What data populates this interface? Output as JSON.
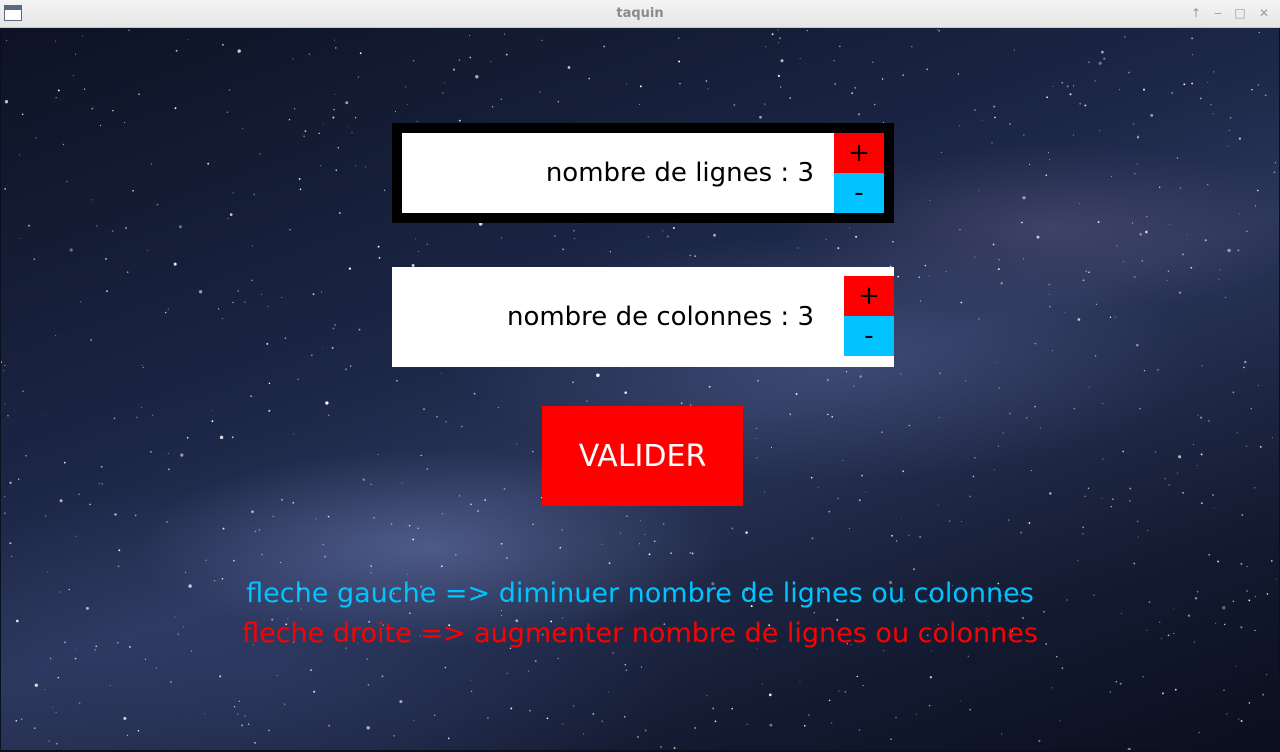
{
  "window": {
    "title": "taquin",
    "controls": [
      "↑",
      "‒",
      "□",
      "✕"
    ]
  },
  "rows_setting": {
    "label": "nombre de lignes : 3",
    "plus": "+",
    "minus": "-"
  },
  "cols_setting": {
    "label": "nombre de colonnes : 3",
    "plus": "+",
    "minus": "-"
  },
  "validate_label": "VALIDER",
  "hints": {
    "left": "fleche gauche => diminuer nombre de lignes ou colonnes",
    "right": "fleche droite => augmenter nombre de lignes ou colonnes"
  },
  "colors": {
    "plus": "#ff0000",
    "minus": "#00c3ff",
    "validate": "#ff0000",
    "hint_left": "#00c3ff",
    "hint_right": "#ff0000"
  }
}
